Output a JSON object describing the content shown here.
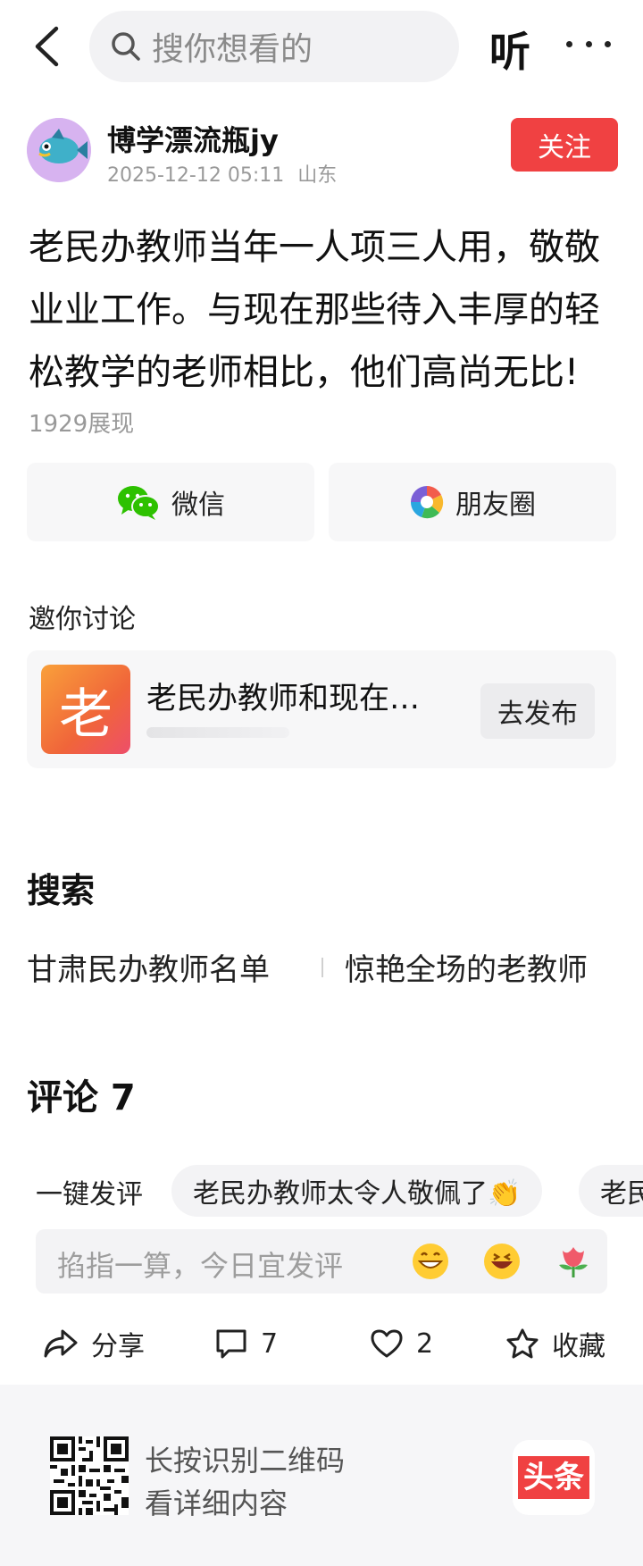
{
  "topbar": {
    "search_placeholder": "搜你想看的",
    "listen_label": "听"
  },
  "author": {
    "name": "博学漂流瓶jy",
    "datetime": "2025-12-12 05:11",
    "location": "山东",
    "follow_label": "关注"
  },
  "post": {
    "text": "老民办教师当年一人项三人用，敬敬业业工作。与现在那些待入丰厚的轻松教学的老师相比，他们高尚无比!",
    "views": "1929展现"
  },
  "share": {
    "wechat_label": "微信",
    "moments_label": "朋友圈"
  },
  "invite": {
    "title": "邀你讨论",
    "thumb_char": "老",
    "topic": "老民办教师和现在…",
    "publish_label": "去发布"
  },
  "search_section": {
    "title": "搜索",
    "items": [
      "甘肃民办教师名单",
      "惊艳全场的老教师"
    ]
  },
  "comments": {
    "title": "评论 7"
  },
  "quick_comment": {
    "label": "一键发评",
    "chips": [
      "老民办教师太令人敬佩了👏",
      "老民"
    ]
  },
  "comment_input": {
    "placeholder": "掐指一算，今日宜发评",
    "emojis": [
      "grinning-face",
      "laughing-face",
      "tulip-flower"
    ]
  },
  "actions": {
    "share_label": "分享",
    "comment_count": "7",
    "like_count": "2",
    "favorite_label": "收藏"
  },
  "footer": {
    "line1": "长按识别二维码",
    "line2": "看详细内容",
    "brand": "头条"
  },
  "colors": {
    "accent_red": "#f04142",
    "muted_text": "#9a9a9a"
  }
}
